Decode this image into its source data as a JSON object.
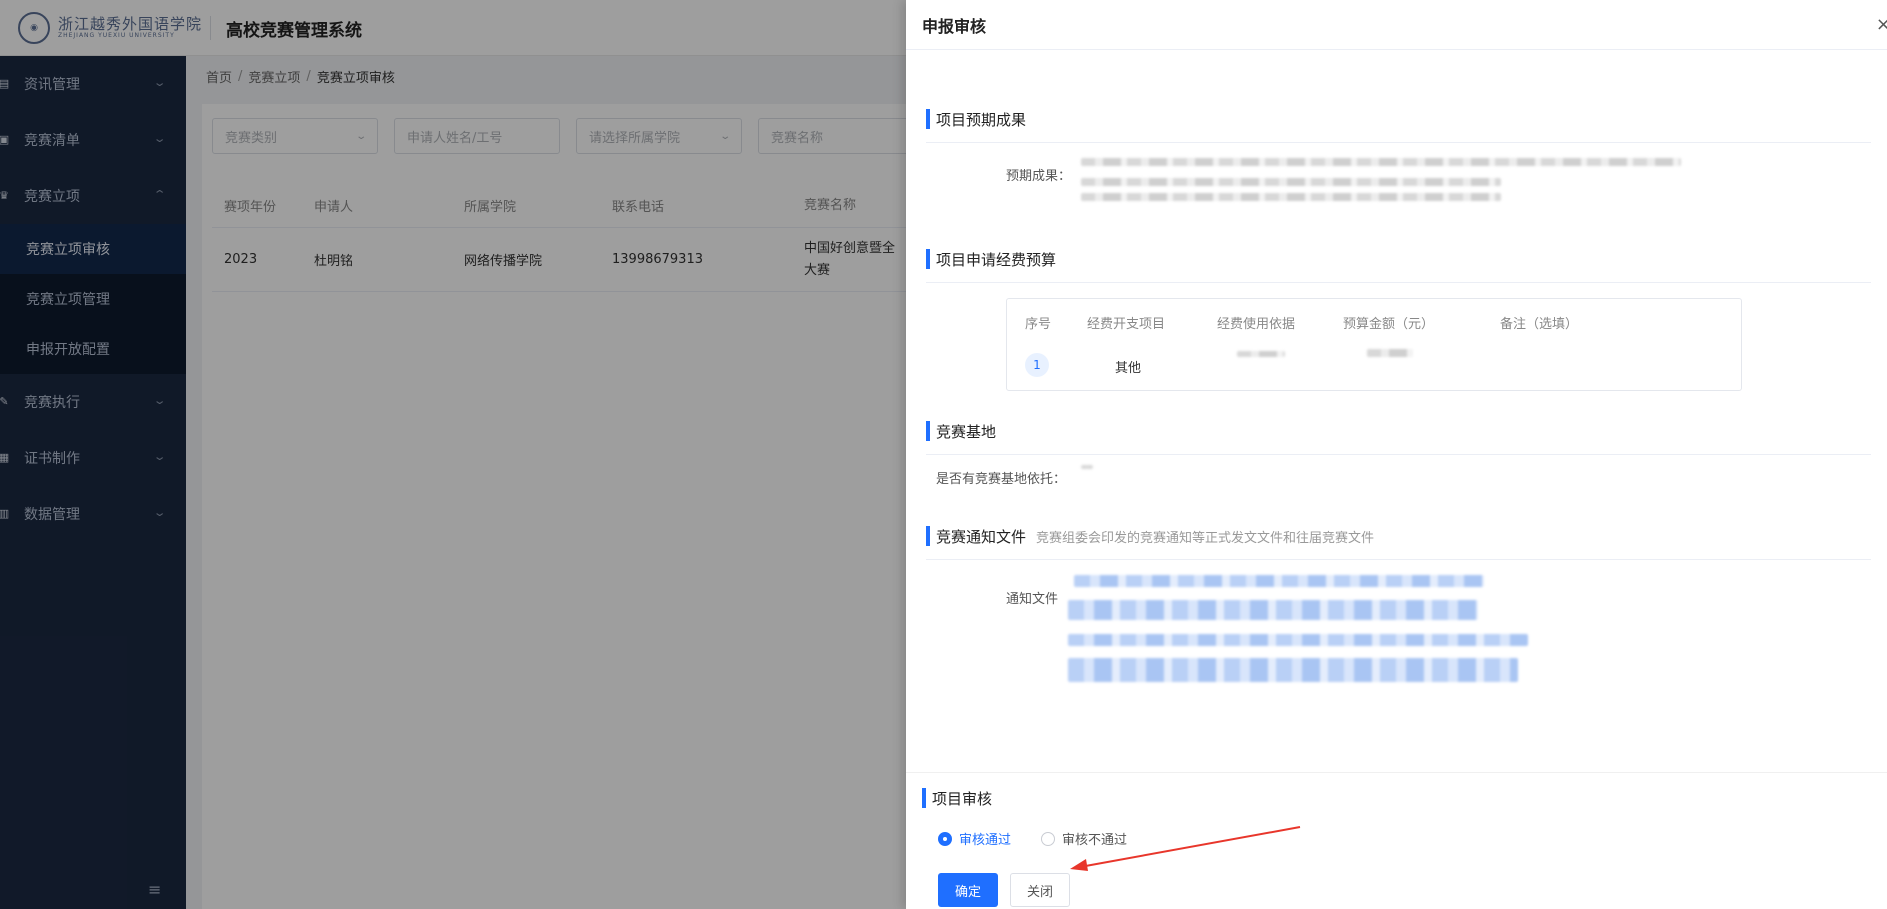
{
  "header": {
    "logo_cn": "浙江越秀外国语学院",
    "logo_en": "ZHEJIANG YUEXIU UNIVERSITY",
    "system_title": "高校竞赛管理系统"
  },
  "sidebar": {
    "items": [
      {
        "label": "资讯管理",
        "icon": "news-icon"
      },
      {
        "label": "竞赛清单",
        "icon": "clipboard-icon"
      },
      {
        "label": "竞赛立项",
        "icon": "trophy-icon",
        "expanded": true,
        "children": [
          {
            "label": "竞赛立项审核",
            "active": true
          },
          {
            "label": "竞赛立项管理"
          },
          {
            "label": "申报开放配置"
          }
        ]
      },
      {
        "label": "竞赛执行",
        "icon": "edit-icon"
      },
      {
        "label": "证书制作",
        "icon": "certificate-icon"
      },
      {
        "label": "数据管理",
        "icon": "chart-icon"
      }
    ]
  },
  "breadcrumb": [
    "首页",
    "竞赛立项",
    "竞赛立项审核"
  ],
  "filters": {
    "category": "竞赛类别",
    "applicant": "申请人姓名/工号",
    "college": "请选择所属学院",
    "name": "竞赛名称"
  },
  "table": {
    "headers": [
      "赛项年份",
      "申请人",
      "所属学院",
      "联系电话",
      "竞赛名称"
    ],
    "rows": [
      {
        "year": "2023",
        "applicant": "杜明铭",
        "college": "网络传播学院",
        "phone": "13998679313",
        "name": "中国好创意暨全\n大赛"
      }
    ]
  },
  "drawer": {
    "title": "申报审核",
    "close": "×",
    "sections": {
      "expected": {
        "title": "项目预期成果",
        "field_label": "预期成果："
      },
      "budget": {
        "title": "项目申请经费预算",
        "headers": [
          "序号",
          "经费开支项目",
          "经费使用依据",
          "预算金额（元）",
          "备注（选填）"
        ],
        "rows": [
          {
            "no": "1",
            "item": "其他"
          }
        ]
      },
      "base": {
        "title": "竞赛基地",
        "field_label": "是否有竞赛基地依托："
      },
      "notice": {
        "title": "竞赛通知文件",
        "subtitle": "竞赛组委会印发的竞赛通知等正式发文文件和往届竞赛文件",
        "field_label": "通知文件"
      }
    },
    "review": {
      "title": "项目审核",
      "options": [
        {
          "label": "审核通过",
          "checked": true
        },
        {
          "label": "审核不通过",
          "checked": false
        }
      ],
      "confirm": "确定",
      "close": "关闭"
    }
  },
  "colors": {
    "primary": "#1f6fff",
    "sidebar_bg": "#1b2942",
    "annotation_arrow": "#e8362b"
  }
}
